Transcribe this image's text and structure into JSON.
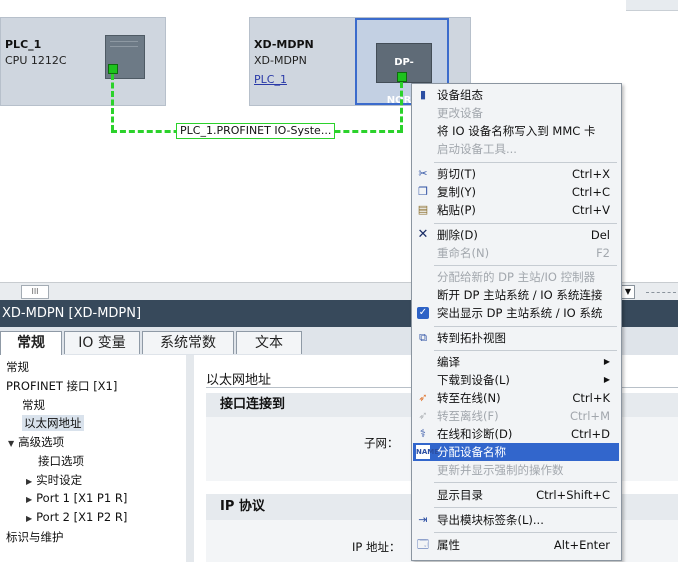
{
  "network": {
    "device1": {
      "name": "PLC_1",
      "type": "CPU 1212C"
    },
    "device2": {
      "name": "XD-MDPN",
      "type": "XD-MDPN",
      "link": "PLC_1",
      "module_label": "DP-NORM"
    },
    "network_label": "PLC_1.PROFINET IO-Syste..."
  },
  "scrollbar": {
    "grip": "III"
  },
  "inspector": {
    "title": "XD-MDPN [XD-MDPN]",
    "tabs": [
      "常规",
      "IO 变量",
      "系统常数",
      "文本"
    ],
    "tree": {
      "general": "常规",
      "profinet": "PROFINET 接口 [X1]",
      "sub_general": "常规",
      "ethernet": "以太网地址",
      "advanced": "高级选项",
      "interface_options": "接口选项",
      "realtime": "实时设定",
      "port1": "Port 1 [X1 P1 R]",
      "port2": "Port 2 [X1 P2 R]",
      "id_maintenance": "标识与维护"
    },
    "content": {
      "header": "以太网地址",
      "section1": "接口连接到",
      "subnet_label": "子网：",
      "section2": "IP 协议",
      "ip_label": "IP 地址："
    }
  },
  "context_menu": {
    "items": [
      {
        "label": "设备组态",
        "shortcut": "",
        "disabled": false
      },
      {
        "label": "更改设备",
        "shortcut": "",
        "disabled": true
      },
      {
        "label": "将 IO 设备名称写入到 MMC 卡",
        "shortcut": "",
        "disabled": false
      },
      {
        "label": "启动设备工具...",
        "shortcut": "",
        "disabled": true
      },
      {
        "label": "剪切(T)",
        "shortcut": "Ctrl+X",
        "disabled": false
      },
      {
        "label": "复制(Y)",
        "shortcut": "Ctrl+C",
        "disabled": false
      },
      {
        "label": "粘贴(P)",
        "shortcut": "Ctrl+V",
        "disabled": false
      },
      {
        "label": "删除(D)",
        "shortcut": "Del",
        "disabled": false
      },
      {
        "label": "重命名(N)",
        "shortcut": "F2",
        "disabled": true
      },
      {
        "label": "分配给新的 DP 主站/IO 控制器",
        "shortcut": "",
        "disabled": true
      },
      {
        "label": "断开 DP 主站系统 / IO 系统连接",
        "shortcut": "",
        "disabled": false
      },
      {
        "label": "突出显示 DP 主站系统 / IO 系统",
        "shortcut": "",
        "disabled": false
      },
      {
        "label": "转到拓扑视图",
        "shortcut": "",
        "disabled": false
      },
      {
        "label": "编译",
        "shortcut": "",
        "disabled": false
      },
      {
        "label": "下载到设备(L)",
        "shortcut": "",
        "disabled": false
      },
      {
        "label": "转至在线(N)",
        "shortcut": "Ctrl+K",
        "disabled": false
      },
      {
        "label": "转至离线(F)",
        "shortcut": "Ctrl+M",
        "disabled": true
      },
      {
        "label": "在线和诊断(D)",
        "shortcut": "Ctrl+D",
        "disabled": false
      },
      {
        "label": "分配设备名称",
        "shortcut": "",
        "disabled": false
      },
      {
        "label": "更新并显示强制的操作数",
        "shortcut": "",
        "disabled": true
      },
      {
        "label": "显示目录",
        "shortcut": "Ctrl+Shift+C",
        "disabled": false
      },
      {
        "label": "导出模块标签条(L)...",
        "shortcut": "",
        "disabled": false
      },
      {
        "label": "属性",
        "shortcut": "Alt+Enter",
        "disabled": false
      }
    ]
  },
  "icons": {
    "device_config": "device-config-icon",
    "cut": "scissors-icon",
    "copy": "copy-icon",
    "paste": "paste-icon",
    "delete": "delete-x-icon",
    "topology": "topology-icon",
    "submenu": "submenu-arrow-icon",
    "go_online": "go-online-icon",
    "go_offline": "go-offline-icon",
    "diagnostics": "diagnostics-icon",
    "assign_name": "assign-name-icon",
    "export": "export-icon",
    "properties": "properties-icon"
  },
  "colors": {
    "network_green": "#2bd22b",
    "menu_highlight": "#3266cc",
    "title_bar": "#37495b"
  }
}
